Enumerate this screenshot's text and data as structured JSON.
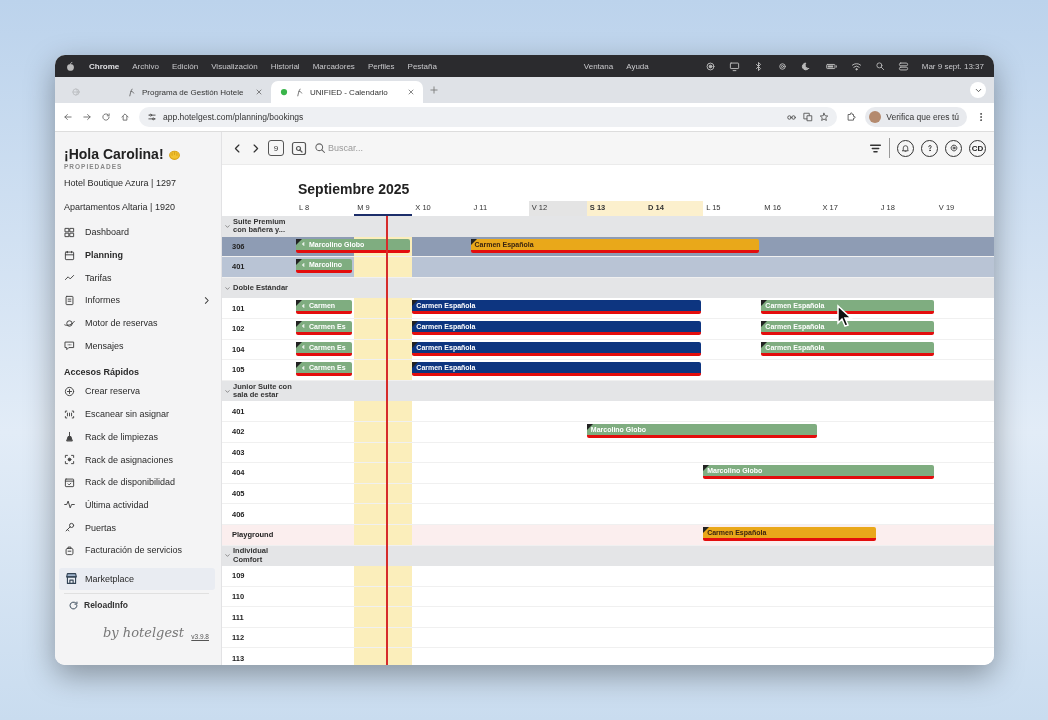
{
  "menubar": {
    "app": "Chrome",
    "items": [
      "Archivo",
      "Edición",
      "Visualización",
      "Historial",
      "Marcadores",
      "Perfiles",
      "Pestaña"
    ],
    "right_items": [
      "Ventana",
      "Ayuda"
    ],
    "clock": "Mar 9 sept. 13:37"
  },
  "tabs": [
    {
      "label": "Programa de Gestión Hotele",
      "selected": false
    },
    {
      "label": "UNIFIED - Calendario",
      "selected": true
    }
  ],
  "address": {
    "url": "app.hotelgest.com/planning/bookings",
    "profile": "Verifica que eres tú"
  },
  "sidebar": {
    "greeting": "¡Hola Carolina!",
    "section": "PROPIEDADES",
    "properties": [
      "Hotel Boutique Azura | 1297",
      "Apartamentos Altaria | 1920"
    ],
    "nav": [
      {
        "label": "Dashboard",
        "selected": false,
        "submenu": false
      },
      {
        "label": "Planning",
        "selected": true,
        "submenu": false
      },
      {
        "label": "Tarifas",
        "selected": false,
        "submenu": false
      },
      {
        "label": "Informes",
        "selected": false,
        "submenu": true
      },
      {
        "label": "Motor de reservas",
        "selected": false,
        "submenu": false
      },
      {
        "label": "Mensajes",
        "selected": false,
        "submenu": false
      }
    ],
    "quick_title": "Accesos Rápidos",
    "quick": [
      "Crear reserva",
      "Escanear sin asignar",
      "Rack de limpiezas",
      "Rack de asignaciones",
      "Rack de disponibilidad",
      "Última actividad",
      "Puertas",
      "Facturación de servicios"
    ],
    "marketplace": "Marketplace",
    "reload": "ReloadInfo",
    "brand": "by hotelgest",
    "version": "v3.9.8"
  },
  "toolbar": {
    "today": "9",
    "search_placeholder": "Buscar...",
    "avatar": "CD"
  },
  "planner": {
    "month": "Septiembre 2025",
    "days": [
      {
        "label": "L 8",
        "kind": "plain",
        "selected": false
      },
      {
        "label": "M 9",
        "kind": "plain",
        "selected": true
      },
      {
        "label": "X 10",
        "kind": "plain",
        "selected": false
      },
      {
        "label": "J 11",
        "kind": "plain",
        "selected": false
      },
      {
        "label": "V 12",
        "kind": "closed",
        "selected": false
      },
      {
        "label": "S 13",
        "kind": "weekend",
        "selected": false
      },
      {
        "label": "D 14",
        "kind": "weekend",
        "selected": false
      },
      {
        "label": "L 15",
        "kind": "plain",
        "selected": false
      },
      {
        "label": "M 16",
        "kind": "plain",
        "selected": false
      },
      {
        "label": "X 17",
        "kind": "plain",
        "selected": false
      },
      {
        "label": "J 18",
        "kind": "plain",
        "selected": false
      },
      {
        "label": "V 19",
        "kind": "plain",
        "selected": false
      }
    ],
    "groups": [
      {
        "name": "Suite Premium con bañera y...",
        "expanded": true,
        "rooms": [
          {
            "name": "306",
            "kind": "selected",
            "cells": [
              {
                "kind": "booking",
                "guest": "Marcolino Globo",
                "color": "#7fad80",
                "continues_left": true
              },
              {
                "kind": "stay"
              },
              {
                "kind": "free"
              },
              {
                "kind": "booking",
                "guest": "Carmen Española",
                "color": "#e9a81a",
                "continues_left": false
              },
              {
                "kind": "stay"
              },
              {
                "kind": "stay"
              },
              {
                "kind": "stay"
              },
              {
                "kind": "stay"
              }
            ]
          },
          {
            "name": "401",
            "kind": "soft",
            "cells": [
              {
                "kind": "booking",
                "guest": "Marcolino",
                "color": "#7fad80",
                "continues_left": true
              }
            ]
          }
        ]
      },
      {
        "name": "Doble Estándar",
        "expanded": true,
        "rooms": [
          {
            "name": "101",
            "kind": "plain",
            "cells": [
              {
                "kind": "booking",
                "guest": "Carmen",
                "color": "#7fad80",
                "continues_left": true
              },
              {
                "kind": "free"
              },
              {
                "kind": "booking",
                "guest": "Carmen Española",
                "color": "#0d3580",
                "continues_left": false
              },
              {
                "kind": "stay"
              },
              {
                "kind": "stay"
              },
              {
                "kind": "stay"
              },
              {
                "kind": "stay"
              },
              {
                "kind": "free"
              },
              {
                "kind": "booking",
                "guest": "Carmen Española",
                "color": "#7fad80",
                "continues_left": false
              },
              {
                "kind": "stay"
              },
              {
                "kind": "stay"
              }
            ]
          },
          {
            "name": "102",
            "kind": "plain",
            "cells": [
              {
                "kind": "booking",
                "guest": "Carmen Es",
                "color": "#7fad80",
                "continues_left": true
              },
              {
                "kind": "free"
              },
              {
                "kind": "booking",
                "guest": "Carmen Española",
                "color": "#0d3580",
                "continues_left": false
              },
              {
                "kind": "stay"
              },
              {
                "kind": "stay"
              },
              {
                "kind": "stay"
              },
              {
                "kind": "stay"
              },
              {
                "kind": "free"
              },
              {
                "kind": "booking",
                "guest": "Carmen Española",
                "color": "#7fad80",
                "continues_left": false
              },
              {
                "kind": "stay"
              },
              {
                "kind": "stay"
              }
            ]
          },
          {
            "name": "104",
            "kind": "plain",
            "cells": [
              {
                "kind": "booking",
                "guest": "Carmen Es",
                "color": "#7fad80",
                "continues_left": true
              },
              {
                "kind": "free"
              },
              {
                "kind": "booking",
                "guest": "Carmen Española",
                "color": "#0d3580",
                "continues_left": false
              },
              {
                "kind": "stay"
              },
              {
                "kind": "stay"
              },
              {
                "kind": "stay"
              },
              {
                "kind": "stay"
              },
              {
                "kind": "free"
              },
              {
                "kind": "booking",
                "guest": "Carmen Española",
                "color": "#7fad80",
                "continues_left": false
              },
              {
                "kind": "stay"
              },
              {
                "kind": "stay"
              }
            ]
          },
          {
            "name": "105",
            "kind": "plain",
            "cells": [
              {
                "kind": "booking",
                "guest": "Carmen Es",
                "color": "#7fad80",
                "continues_left": true
              },
              {
                "kind": "free"
              },
              {
                "kind": "booking",
                "guest": "Carmen Española",
                "color": "#0d3580",
                "continues_left": false
              },
              {
                "kind": "stay"
              },
              {
                "kind": "stay"
              },
              {
                "kind": "stay"
              },
              {
                "kind": "stay"
              }
            ]
          }
        ]
      },
      {
        "name": "Junior Suite con sala de estar",
        "expanded": true,
        "rooms": [
          {
            "name": "401",
            "kind": "plain"
          },
          {
            "name": "402",
            "kind": "plain",
            "cells": [
              {
                "kind": "free"
              },
              {
                "kind": "free"
              },
              {
                "kind": "free"
              },
              {
                "kind": "free"
              },
              {
                "kind": "free"
              },
              {
                "kind": "booking",
                "guest": "Marcolino Globo",
                "color": "#7fad80",
                "continues_left": false
              },
              {
                "kind": "stay"
              },
              {
                "kind": "stay"
              },
              {
                "kind": "stay"
              }
            ]
          },
          {
            "name": "403",
            "kind": "plain"
          },
          {
            "name": "404",
            "kind": "plain",
            "cells": [
              {
                "kind": "free"
              },
              {
                "kind": "free"
              },
              {
                "kind": "free"
              },
              {
                "kind": "free"
              },
              {
                "kind": "free"
              },
              {
                "kind": "free"
              },
              {
                "kind": "free"
              },
              {
                "kind": "booking",
                "guest": "Marcolino Globo",
                "color": "#7fad80",
                "continues_left": false
              },
              {
                "kind": "stay"
              },
              {
                "kind": "stay"
              },
              {
                "kind": "stay"
              }
            ]
          },
          {
            "name": "405",
            "kind": "plain"
          },
          {
            "name": "406",
            "kind": "plain"
          },
          {
            "name": "Playground",
            "kind": "event",
            "cells": [
              {
                "kind": "free"
              },
              {
                "kind": "free"
              },
              {
                "kind": "free"
              },
              {
                "kind": "free"
              },
              {
                "kind": "free"
              },
              {
                "kind": "free"
              },
              {
                "kind": "free"
              },
              {
                "kind": "booking",
                "guest": "Carmen Española",
                "color": "#e9a81a",
                "continues_left": false
              },
              {
                "kind": "stay"
              },
              {
                "kind": "stay"
              }
            ]
          }
        ]
      },
      {
        "name": "Individual Comfort",
        "expanded": true,
        "rooms": [
          {
            "name": "109",
            "kind": "plain"
          },
          {
            "name": "110",
            "kind": "plain"
          },
          {
            "name": "111",
            "kind": "plain"
          },
          {
            "name": "112",
            "kind": "plain"
          },
          {
            "name": "113",
            "kind": "plain"
          }
        ]
      }
    ]
  }
}
